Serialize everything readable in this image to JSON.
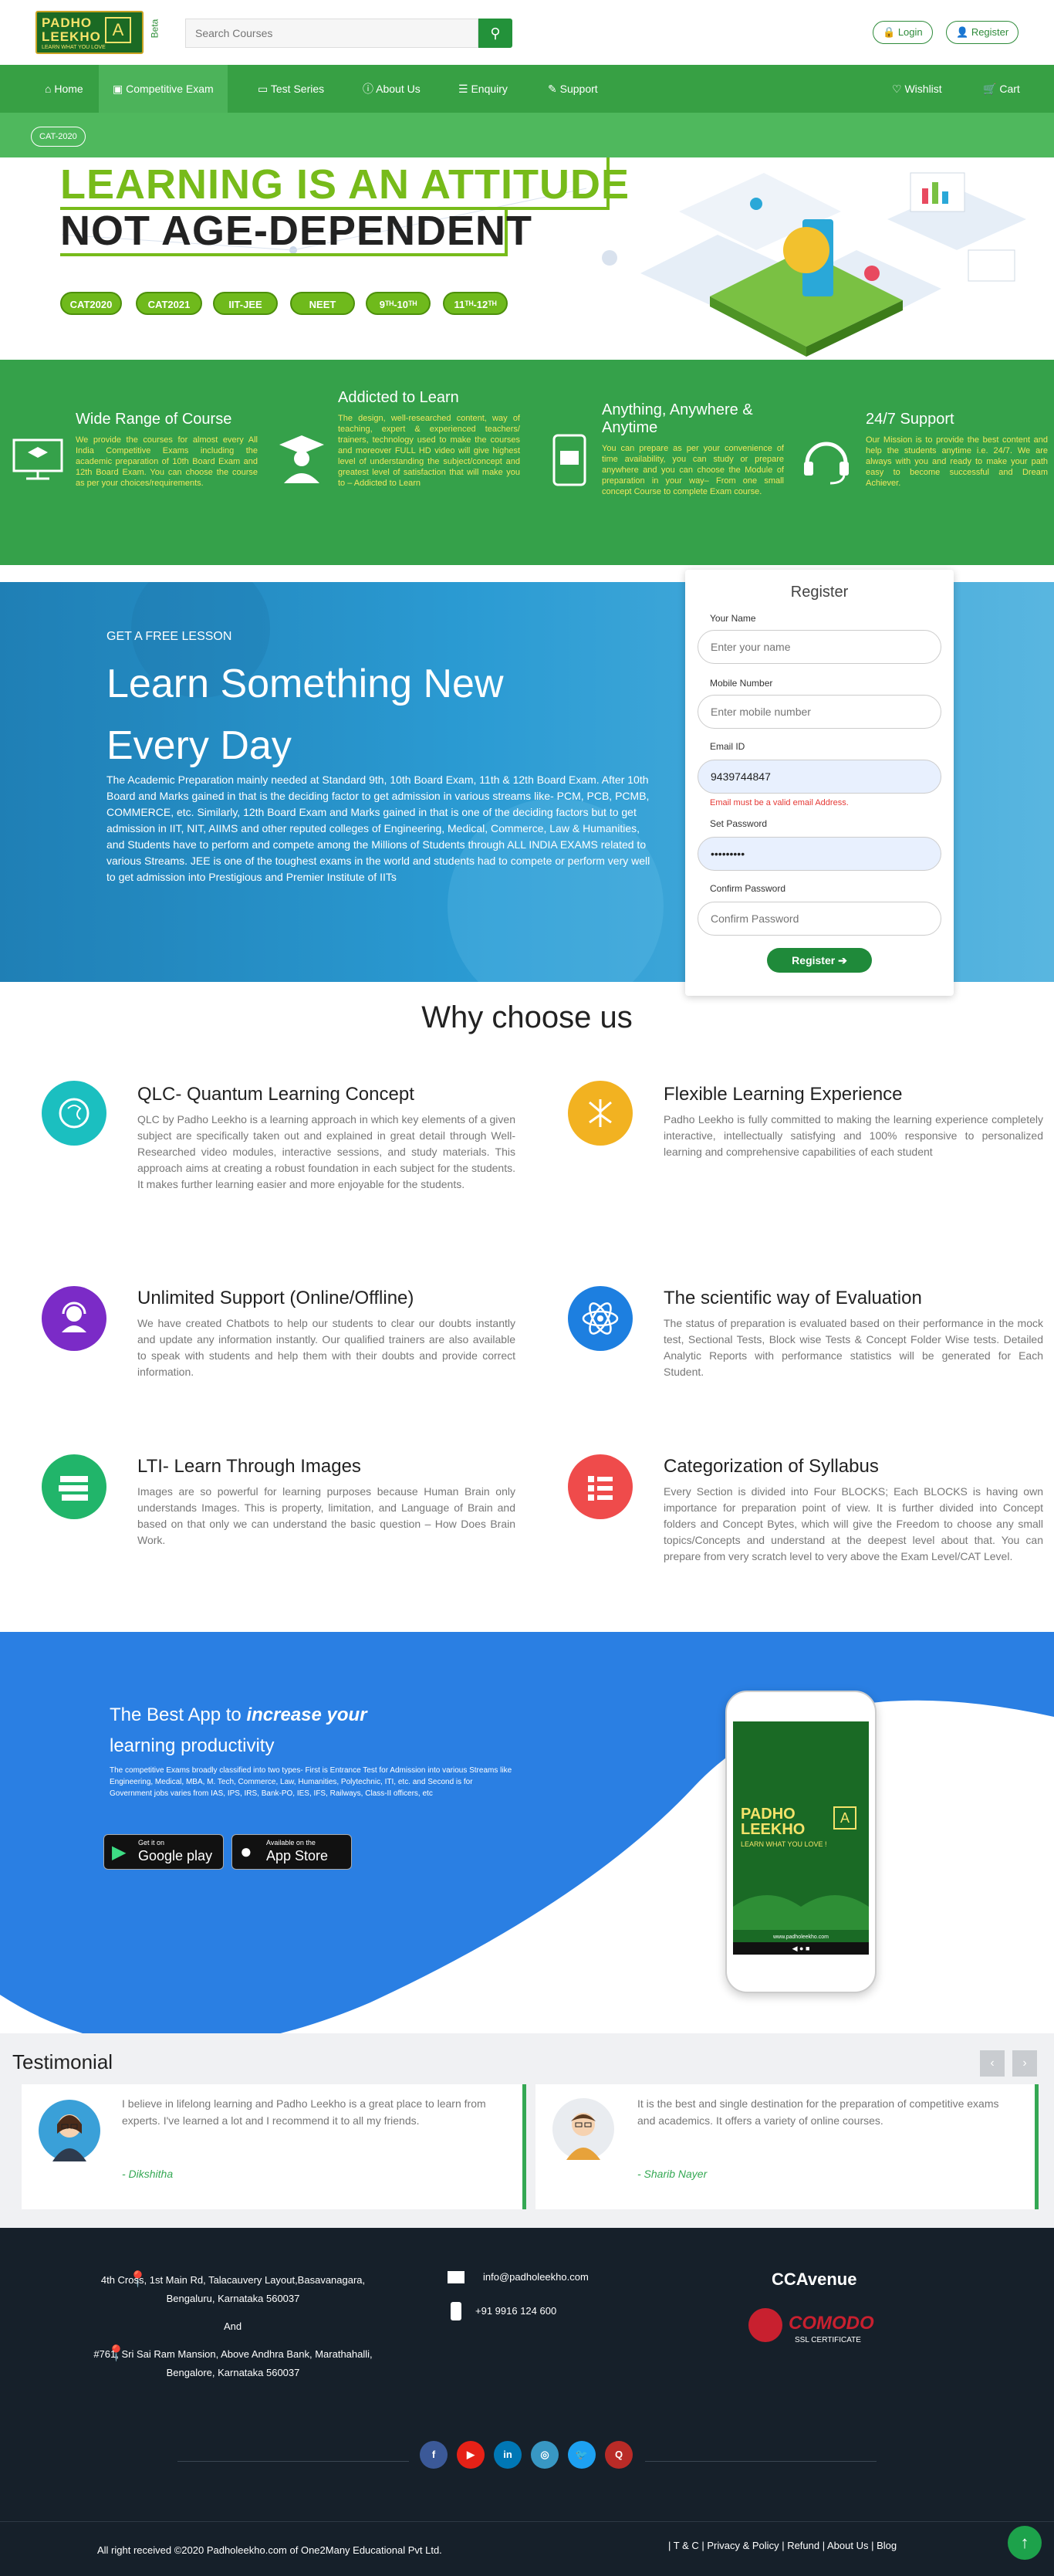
{
  "header": {
    "logo_line1": "PADHO",
    "logo_line2": "LEEKHO",
    "logo_tagline": "LEARN WHAT YOU LOVE",
    "beta": "Beta",
    "search_placeholder": "Search Courses",
    "login": "Login",
    "register": "Register"
  },
  "nav": {
    "items": [
      {
        "label": "Home"
      },
      {
        "label": "Competitive Exam"
      },
      {
        "label": "Test Series"
      },
      {
        "label": "About Us"
      },
      {
        "label": "Enquiry"
      },
      {
        "label": "Support"
      }
    ],
    "wishlist": "Wishlist",
    "cart": "Cart",
    "sub_chip": "CAT-2020"
  },
  "hero": {
    "line1": "LEARNING IS AN ATTITUDE",
    "line2": "NOT AGE-DEPENDENT",
    "tags": [
      "CAT2020",
      "CAT2021",
      "IIT-JEE",
      "NEET",
      "9ᵀᴴ-10ᵀᴴ",
      "11ᵀᴴ-12ᵀᴴ"
    ]
  },
  "features": [
    {
      "title": "Wide Range of Course",
      "text": "We provide the courses for almost every All India Competitive Exams including the academic preparation of 10th Board Exam and 12th Board Exam. You can choose the course as per your choices/requirements."
    },
    {
      "title": "Addicted to Learn",
      "text": "The design, well-researched content, way of teaching, expert & experienced teachers/ trainers, technology used to make the courses and moreover FULL HD video will give highest level of understanding the subject/concept and greatest level of satisfaction that will make you to – Addicted to Learn"
    },
    {
      "title": "Anything, Anywhere & Anytime",
      "text": "You can prepare as per your convenience of time availability, you can study or prepare anywhere and you can choose the Module of preparation in your way– From one small concept Course to complete Exam course."
    },
    {
      "title": "24/7 Support",
      "text": "Our Mission is to provide the best content and help the students anytime i.e. 24/7. We are always with you and ready to make your path easy to become successful and Dream Achiever."
    }
  ],
  "lesson": {
    "kicker": "GET A FREE LESSON",
    "title": "Learn Something New Every Day",
    "body": "The Academic Preparation mainly needed at Standard 9th, 10th Board Exam, 11th & 12th Board Exam. After 10th Board and Marks gained in that is the deciding factor to get admission in various streams like- PCM, PCB, PCMB, COMMERCE, etc. Similarly, 12th Board Exam and Marks gained in that is one of the deciding factors but to get admission in IIT, NIT, AIIMS and other reputed colleges of Engineering, Medical, Commerce, Law & Humanities, and Students have to perform and compete among the Millions of Students through ALL INDIA EXAMS related to various Streams. JEE is one of the toughest exams in the world and students had to compete or perform very well to get admission into Prestigious and Premier Institute of IITs"
  },
  "register_form": {
    "title": "Register",
    "name_label": "Your Name",
    "name_placeholder": "Enter your name",
    "mobile_label": "Mobile Number",
    "mobile_placeholder": "Enter mobile number",
    "email_label": "Email ID",
    "email_value": "9439744847",
    "email_error": "Email must be a valid email Address.",
    "password_label": "Set Password",
    "password_value": "•••••••••",
    "confirm_label": "Confirm Password",
    "confirm_placeholder": "Confirm Password",
    "submit": "Register"
  },
  "why": {
    "title": "Why choose us",
    "items": [
      {
        "title": "QLC- Quantum Learning Concept",
        "text": "QLC by Padho Leekho is a learning approach in which key elements of a given subject are specifically taken out and explained in great detail through Well-Researched video modules, interactive sessions, and study materials. This approach aims at creating a robust foundation in each subject for the students. It makes further learning easier and more enjoyable for the students.",
        "color": "#1bbfc0"
      },
      {
        "title": "Flexible Learning Experience",
        "text": "Padho Leekho is fully committed to making the learning experience completely interactive, intellectually satisfying and 100% responsive to personalized learning and comprehensive capabilities of each student",
        "color": "#f2b221"
      },
      {
        "title": "Unlimited Support (Online/Offline)",
        "text": "We have created Chatbots to help our students to clear our doubts instantly and update any information instantly. Our qualified trainers are also available to speak with students and help them with their doubts and provide correct information.",
        "color": "#7b2bc7"
      },
      {
        "title": "The scientific way of Evaluation",
        "text": "The status of preparation is evaluated based on their performance in the mock test, Sectional Tests, Block wise Tests & Concept Folder Wise tests. Detailed Analytic Reports with performance statistics will be generated for Each Student.",
        "color": "#1d7fe0"
      },
      {
        "title": "LTI- Learn Through Images",
        "text": "Images are so powerful for learning purposes because Human Brain only understands Images. This is property, limitation, and Language of Brain and based on that only we can understand the basic question – How Does Brain Work.",
        "color": "#21b56a"
      },
      {
        "title": "Categorization of Syllabus",
        "text": "Every Section is divided into Four BLOCKS; Each BLOCKS is having own importance for preparation point of view. It is further divided into Concept folders and Concept Bytes, which will give the Freedom to choose any small topics/Concepts and understand at the deepest level about that. You can prepare from very scratch level to very above the Exam Level/CAT Level.",
        "color": "#ef4b4b"
      }
    ]
  },
  "app": {
    "heading_pre": "The Best App to ",
    "heading_em": "increase your",
    "heading_post": "learning productivity",
    "body": "The competitive Exams broadly classified into two types- First is Entrance Test for Admission into various Streams like Engineering, Medical, MBA, M. Tech, Commerce, Law, Humanities, Polytechnic, ITI, etc. and Second is for Government jobs varies from IAS, IPS, IRS, Bank-PO, IES, IFS, Railways, Class-II officers, etc",
    "gplay_small": "Get it on",
    "gplay_big": "Google play",
    "apple_small": "Available on the",
    "apple_big": "App Store",
    "phone_logo1": "PADHO",
    "phone_logo2": "LEEKHO",
    "phone_tag": "LEARN WHAT YOU LOVE !",
    "phone_url": "www.padholeekho.com"
  },
  "testimonial": {
    "title": "Testimonial",
    "items": [
      {
        "quote": "I believe in lifelong learning and Padho Leekho is a great place to learn from experts. I've learned a lot and I recommend it to all my friends.",
        "name": "- Dikshitha"
      },
      {
        "quote": "It is the best and single destination for the preparation of competitive exams and academics. It offers a variety of online courses.",
        "name": "- Sharib Nayer"
      }
    ]
  },
  "footer": {
    "addr1": "4th Cross, 1st Main Rd, Talacauvery Layout,Basavanagara, Bengaluru, Karnataka 560037",
    "and": "And",
    "addr2": "#761, Sri Sai Ram Mansion, Above Andhra Bank, Marathahalli, Bengalore, Karnataka 560037",
    "email": "info@padholeekho.com",
    "phone": "+91 9916 124 600",
    "ccavenue": "CCAvenue",
    "comodo": "COMODO",
    "comodo_sub": "SSL CERTIFICATE",
    "copyright": "All right received ©2020 Padholeekho.com of One2Many Educational Pvt Ltd.",
    "links": [
      "T & C",
      "Privacy & Policy",
      "Refund",
      "About Us",
      "Blog"
    ],
    "social": [
      "f",
      "▶",
      "in",
      "◎",
      "🐦",
      "Q"
    ]
  }
}
